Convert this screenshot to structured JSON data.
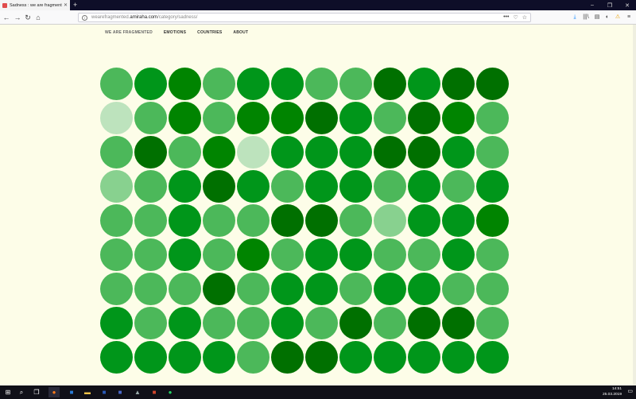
{
  "browser": {
    "tab_title": "Sadness : we are fragmented",
    "new_tab_label": "+",
    "url_prefix": "wearefragmented.",
    "url_domain": "amiraha.com",
    "url_path": "/category/sadness/",
    "window_controls": [
      "–",
      "❐",
      "✕"
    ],
    "nav_icons": [
      "←",
      "→",
      "↻",
      "⌂"
    ],
    "url_icons": [
      "•••",
      "♡",
      "☆"
    ],
    "toolbar_icons": [
      "⤓",
      "|||\\",
      "▤",
      "◐",
      "⚠",
      "≡"
    ]
  },
  "site_nav": {
    "brand": "WE ARE FRAGMENTED",
    "items": [
      "EMOTIONS",
      "COUNTRIES",
      "ABOUT"
    ]
  },
  "palette": {
    "a": "#4cb85a",
    "b": "#00961a",
    "c": "#008400",
    "d": "#007000",
    "e": "#bde3bd",
    "f": "#88d18f"
  },
  "grid": [
    "abcabbaadbdd",
    "eacaccdbadca",
    "adacebbbddba",
    "fabdbabbabab",
    "aabaaddaf bbc",
    "aabacabbaaba",
    "aaadabbabbaa",
    "babaabadadda",
    "bbbbaddbbbbb"
  ],
  "taskbar": {
    "time": "14:51",
    "date": "25.03.2019"
  }
}
